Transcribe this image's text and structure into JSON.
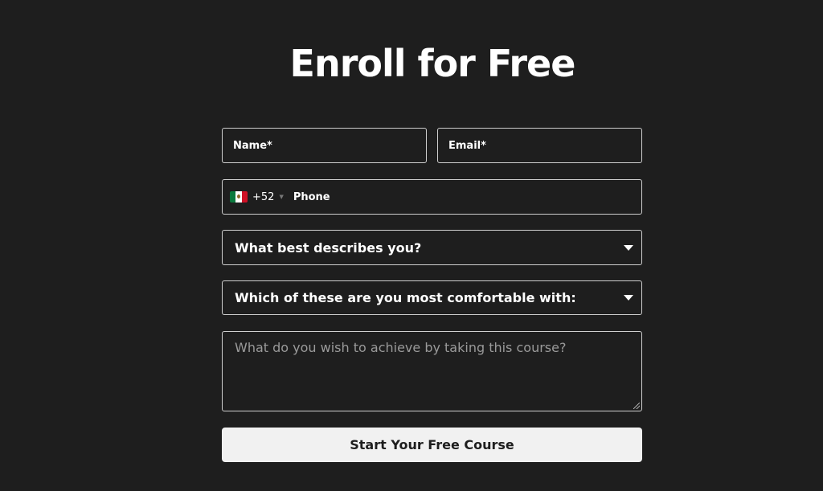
{
  "form": {
    "title": "Enroll for Free",
    "name_placeholder": "Name*",
    "email_placeholder": "Email*",
    "phone": {
      "country_flag": "mexico-flag-icon",
      "dial_code": "+52",
      "placeholder": "Phone"
    },
    "describes_select": {
      "selected": "What best describes you?",
      "icon": "caret-down-icon"
    },
    "comfortable_select": {
      "selected": "Which of these are you most comfortable with:",
      "icon": "caret-down-icon"
    },
    "goal_placeholder": "What do you wish to achieve by taking this course?",
    "submit_label": "Start Your Free Course"
  },
  "colors": {
    "background": "#1e1e1e",
    "field_border": "#cfcfcf",
    "button_background": "#f1f1f1",
    "button_text": "#1e1e1e",
    "placeholder_muted": "#9a9a9a"
  }
}
